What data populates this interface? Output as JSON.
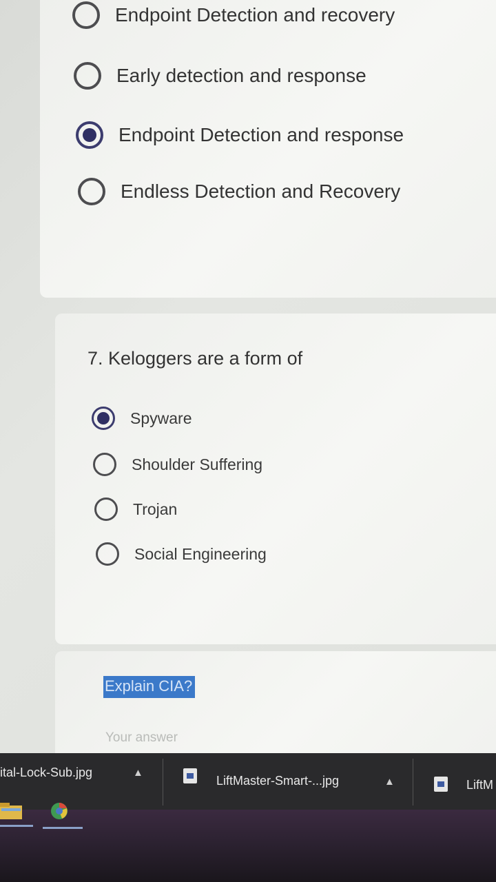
{
  "previous_question": {
    "options": [
      {
        "label": "Endpoint Detection and recovery",
        "selected": false
      },
      {
        "label": "Early detection and response",
        "selected": false
      },
      {
        "label": "Endpoint Detection and response",
        "selected": true
      },
      {
        "label": "Endless Detection and Recovery",
        "selected": false
      }
    ]
  },
  "question7": {
    "title": "7. Keloggers are a form of",
    "options": [
      {
        "label": "Spyware",
        "selected": true
      },
      {
        "label": "Shoulder Suffering",
        "selected": false
      },
      {
        "label": "Trojan",
        "selected": false
      },
      {
        "label": "Social Engineering",
        "selected": false
      }
    ]
  },
  "question8": {
    "title": "Explain CIA?",
    "placeholder": "Your answer"
  },
  "downloads": {
    "items": [
      {
        "name": "ital-Lock-Sub.jpg",
        "icon": "image-file-icon"
      },
      {
        "name": "LiftMaster-Smart-...jpg",
        "icon": "image-file-icon"
      },
      {
        "name": "LiftM",
        "icon": "image-file-icon"
      }
    ]
  },
  "taskbar": {
    "apps": [
      "file-explorer-icon",
      "chrome-icon"
    ]
  }
}
